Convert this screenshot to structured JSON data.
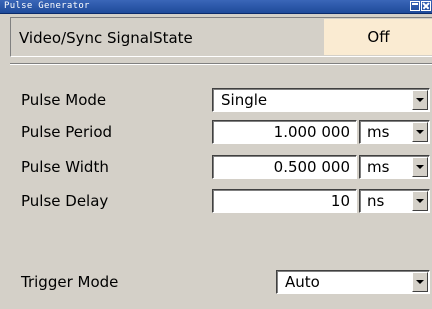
{
  "window": {
    "title": "Pulse Generator"
  },
  "state": {
    "label": "Video/Sync SignalState",
    "value": "Off"
  },
  "fields": {
    "pulse_mode": {
      "label": "Pulse Mode",
      "value": "Single"
    },
    "pulse_period": {
      "label": "Pulse Period",
      "value": "1.000 000",
      "unit": "ms"
    },
    "pulse_width": {
      "label": "Pulse Width",
      "value": "0.500 000",
      "unit": "ms"
    },
    "pulse_delay": {
      "label": "Pulse Delay",
      "value": "10",
      "unit": "ns"
    },
    "trigger_mode": {
      "label": "Trigger Mode",
      "value": "Auto"
    }
  },
  "colors": {
    "title_bar": "#1e4a9a",
    "state_value_bg": "#faebd2",
    "panel_bg": "#d4d0c8"
  }
}
